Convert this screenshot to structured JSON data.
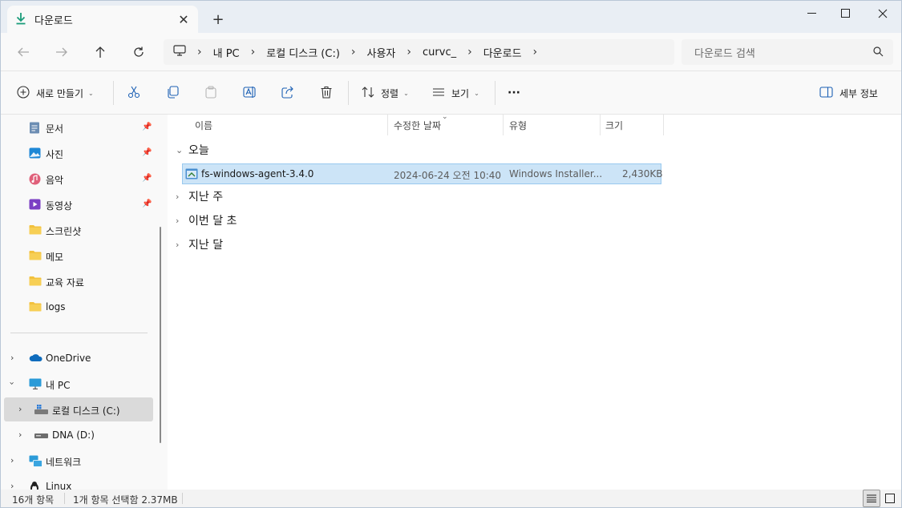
{
  "tab": {
    "title": "다운로드",
    "icon": "download-icon"
  },
  "address": {
    "crumbs": [
      "내 PC",
      "로컬 디스크 (C:)",
      "사용자",
      "curvc_",
      "다운로드"
    ],
    "search_placeholder": "다운로드 검색"
  },
  "toolbar": {
    "new_label": "새로 만들기",
    "sort_label": "정렬",
    "view_label": "보기",
    "more_label": "···",
    "details_label": "세부 정보"
  },
  "sidebar": {
    "quick": [
      {
        "label": "문서",
        "icon": "document-icon",
        "pinned": true
      },
      {
        "label": "사진",
        "icon": "pictures-icon",
        "pinned": true
      },
      {
        "label": "음악",
        "icon": "music-icon",
        "pinned": true
      },
      {
        "label": "동영상",
        "icon": "videos-icon",
        "pinned": true
      },
      {
        "label": "스크린샷",
        "icon": "folder-icon",
        "pinned": false
      },
      {
        "label": "메모",
        "icon": "folder-icon",
        "pinned": false
      },
      {
        "label": "교육 자료",
        "icon": "folder-icon",
        "pinned": false
      },
      {
        "label": "logs",
        "icon": "folder-icon",
        "pinned": false
      }
    ],
    "tree": [
      {
        "label": "OneDrive",
        "icon": "onedrive-icon"
      },
      {
        "label": "내 PC",
        "icon": "pc-icon"
      },
      {
        "label": "로컬 디스크 (C:)",
        "icon": "drive-c-icon"
      },
      {
        "label": "DNA (D:)",
        "icon": "drive-d-icon"
      },
      {
        "label": "네트워크",
        "icon": "network-icon"
      },
      {
        "label": "Linux",
        "icon": "linux-icon"
      }
    ]
  },
  "columns": [
    "이름",
    "수정한 날짜",
    "유형",
    "크기"
  ],
  "groups": [
    "오늘",
    "지난 주",
    "이번 달 초",
    "지난 달"
  ],
  "files": [
    {
      "name": "fs-windows-agent-3.4.0",
      "modified": "2024-06-24 오전 10:40",
      "type": "Windows Installer...",
      "size": "2,430KB"
    }
  ],
  "status": {
    "count": "16개 항목",
    "selection": "1개 항목 선택함 2.37MB"
  },
  "colors": {
    "accent": "#0067c0",
    "selection_bg": "#cce4f7",
    "folder": "#f2c13d"
  }
}
